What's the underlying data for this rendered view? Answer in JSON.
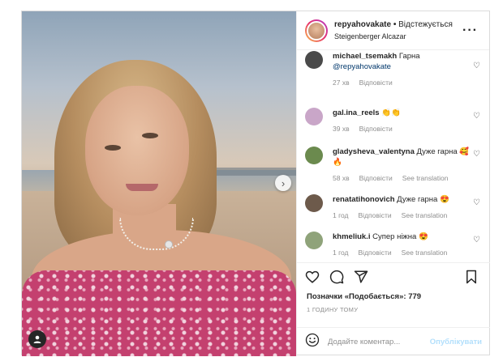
{
  "header": {
    "username": "repyahovakate",
    "separator": "•",
    "follow_label": "Відстежується",
    "location": "Steigenberger Alcazar",
    "more_icon": "more-horizontal-icon"
  },
  "comments": [
    {
      "username": "michael_tsemakh",
      "text": " Гарна ",
      "mention": "@repyahovakate",
      "time": "27 хв",
      "reply": "Відповісти",
      "translate": "",
      "avatar_color": "#4a4a4a"
    },
    {
      "username": "gal.ina_reels",
      "text": " 👏👏",
      "mention": "",
      "time": "39 хв",
      "reply": "Відповісти",
      "translate": "",
      "avatar_color": "#c9a6c8"
    },
    {
      "username": "gladysheva_valentyna",
      "text": " Дуже гарна 🥰🔥",
      "mention": "",
      "time": "58 хв",
      "reply": "Відповісти",
      "translate": "See translation",
      "avatar_color": "#6b8a4e"
    },
    {
      "username": "renatatihonovich",
      "text": " Дуже гарна 😍",
      "mention": "",
      "time": "1 год",
      "reply": "Відповісти",
      "translate": "See translation",
      "avatar_color": "#6d5a4b"
    },
    {
      "username": "khmeliuk.i",
      "text": " Супер ніжна 😍",
      "mention": "",
      "time": "1 год",
      "reply": "Відповісти",
      "translate": "See translation",
      "avatar_color": "#8fa37a"
    }
  ],
  "likes": {
    "label": "Позначки «Подобається»: 779"
  },
  "time_ago": "1 ГОДИНУ ТОМУ",
  "add_comment": {
    "placeholder": "Додайте коментар...",
    "publish_label": "Опублікувати"
  },
  "colors": {
    "link": "#00376b",
    "publish_disabled": "#b2dffc",
    "meta": "#8e8e8e"
  }
}
